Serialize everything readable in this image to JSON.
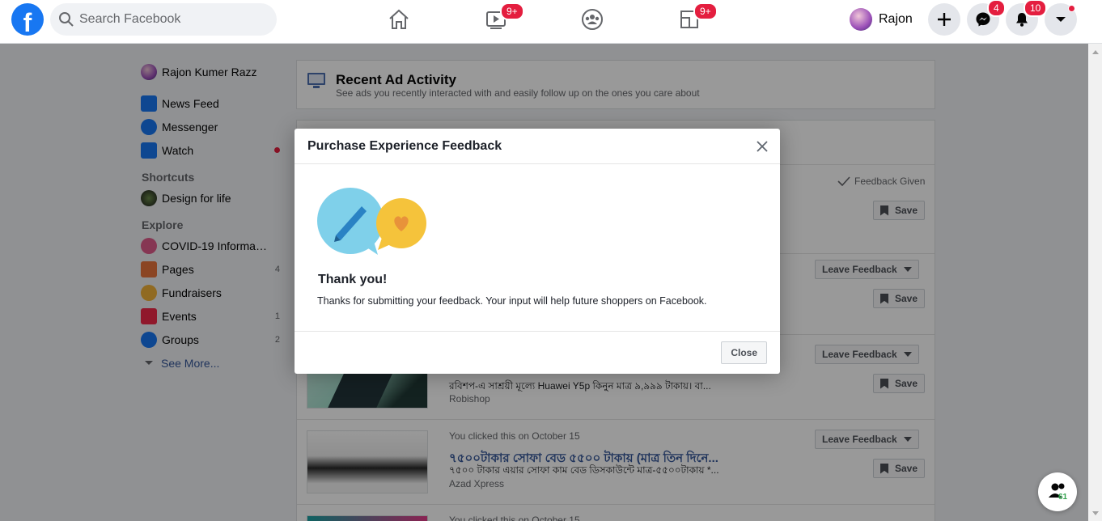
{
  "topbar": {
    "logo_letter": "f",
    "search_placeholder": "Search Facebook",
    "watch_badge": "9+",
    "gaming_badge": "9+",
    "profile_name": "Rajon",
    "messenger_badge": "4",
    "notifications_badge": "10"
  },
  "sidebar": {
    "profile": "Rajon Kumer Razz",
    "items": [
      {
        "label": "News Feed",
        "icon": "news-feed-icon"
      },
      {
        "label": "Messenger",
        "icon": "messenger-icon"
      },
      {
        "label": "Watch",
        "icon": "watch-icon"
      }
    ],
    "shortcuts_heading": "Shortcuts",
    "shortcut": "Design for life",
    "explore_heading": "Explore",
    "explore": [
      {
        "label": "COVID-19 Informati...",
        "count": ""
      },
      {
        "label": "Pages",
        "count": "4"
      },
      {
        "label": "Fundraisers",
        "count": ""
      },
      {
        "label": "Events",
        "count": "1"
      },
      {
        "label": "Groups",
        "count": "2"
      }
    ],
    "see_more": "See More..."
  },
  "main": {
    "header_title": "Recent Ad Activity",
    "header_sub": "See ads you recently interacted with and easily follow up on the ones you care about",
    "feedback_given": "Feedback Given",
    "save": "Save",
    "leave_feedback": "Leave Feedback",
    "ad3": {
      "desc": "রবিশপ-এ সাশ্রয়ী মূল্যে Huawei Y5p কিনুন মাত্র ৯,৯৯৯ টাকায়। বা...",
      "source": "Robishop"
    },
    "ad4": {
      "clicked": "You clicked this on October 15",
      "title": "৭৫০০টাকার সোফা বেড ৫৫০০ টাকায় (মাত্র তিন দিনে...",
      "desc": "৭৫০০ টাকার এয়ার সোফা কাম বেড ডিসকাউন্টে মাত্র-৫৫০০টাকায় *...",
      "source": "Azad Xpress"
    },
    "ad5_clicked": "You clicked this on October 15"
  },
  "modal": {
    "title": "Purchase Experience Feedback",
    "thanks": "Thank you!",
    "body": "Thanks for submitting your feedback. Your input will help future shoppers on Facebook.",
    "close": "Close"
  },
  "contacts_count": "61",
  "colors": {
    "brand": "#1877f2",
    "badge": "#e41e3f",
    "link": "#365899"
  }
}
